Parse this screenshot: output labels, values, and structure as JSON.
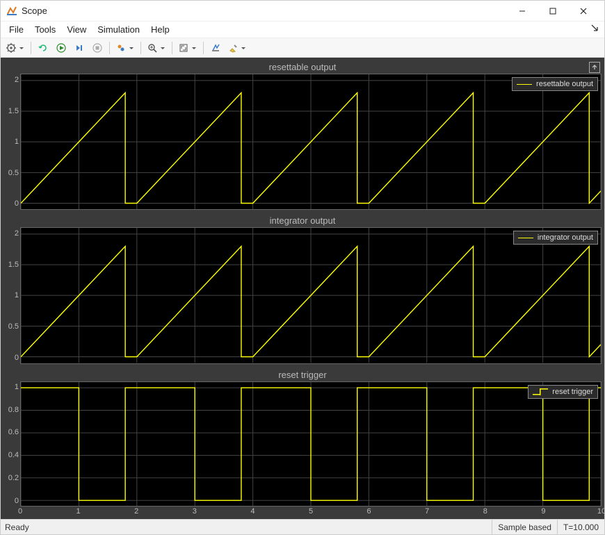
{
  "window": {
    "title": "Scope"
  },
  "menubar": {
    "file": "File",
    "tools": "Tools",
    "view": "View",
    "simulation": "Simulation",
    "help": "Help"
  },
  "statusbar": {
    "ready": "Ready",
    "mode": "Sample based",
    "time": "T=10.000"
  },
  "subplots": [
    {
      "title": "resettable output",
      "legend": "resettable output"
    },
    {
      "title": "integrator output",
      "legend": "integrator output"
    },
    {
      "title": "reset trigger",
      "legend": "reset trigger"
    }
  ],
  "chart_data": [
    {
      "type": "line",
      "title": "resettable output",
      "xlabel": "",
      "ylabel": "",
      "xlim": [
        0,
        10
      ],
      "ylim": [
        -0.1,
        2.1
      ],
      "xticks": [
        0,
        1,
        2,
        3,
        4,
        5,
        6,
        7,
        8,
        9,
        10
      ],
      "yticks": [
        0,
        0.5,
        1,
        1.5,
        2
      ],
      "series": [
        {
          "name": "resettable output",
          "x": [
            0,
            1.8,
            1.8,
            2,
            3.8,
            3.8,
            4,
            5.8,
            5.8,
            6,
            7.8,
            7.8,
            8,
            9.8,
            9.8,
            10
          ],
          "y": [
            0,
            1.8,
            0,
            0,
            1.8,
            0,
            0,
            1.8,
            0,
            0,
            1.8,
            0,
            0,
            1.8,
            0,
            0.2
          ]
        }
      ]
    },
    {
      "type": "line",
      "title": "integrator output",
      "xlabel": "",
      "ylabel": "",
      "xlim": [
        0,
        10
      ],
      "ylim": [
        -0.1,
        2.1
      ],
      "xticks": [
        0,
        1,
        2,
        3,
        4,
        5,
        6,
        7,
        8,
        9,
        10
      ],
      "yticks": [
        0,
        0.5,
        1,
        1.5,
        2
      ],
      "series": [
        {
          "name": "integrator output",
          "x": [
            0,
            1.8,
            1.8,
            2,
            3.8,
            3.8,
            4,
            5.8,
            5.8,
            6,
            7.8,
            7.8,
            8,
            9.8,
            9.8,
            10
          ],
          "y": [
            0,
            1.8,
            0,
            0,
            1.8,
            0,
            0,
            1.8,
            0,
            0,
            1.8,
            0,
            0,
            1.8,
            0,
            0.2
          ]
        }
      ]
    },
    {
      "type": "line",
      "title": "reset trigger",
      "xlabel": "",
      "ylabel": "",
      "xlim": [
        0,
        10
      ],
      "ylim": [
        -0.05,
        1.05
      ],
      "xticks": [
        0,
        1,
        2,
        3,
        4,
        5,
        6,
        7,
        8,
        9,
        10
      ],
      "yticks": [
        0,
        0.2,
        0.4,
        0.6,
        0.8,
        1
      ],
      "series": [
        {
          "name": "reset trigger",
          "x": [
            0,
            1,
            1,
            1.8,
            1.8,
            3,
            3,
            3.8,
            3.8,
            5,
            5,
            5.8,
            5.8,
            7,
            7,
            7.8,
            7.8,
            9,
            9,
            9.8,
            9.8,
            10
          ],
          "y": [
            1,
            1,
            0,
            0,
            1,
            1,
            0,
            0,
            1,
            1,
            0,
            0,
            1,
            1,
            0,
            0,
            1,
            1,
            0,
            0,
            1,
            1
          ]
        }
      ]
    }
  ]
}
